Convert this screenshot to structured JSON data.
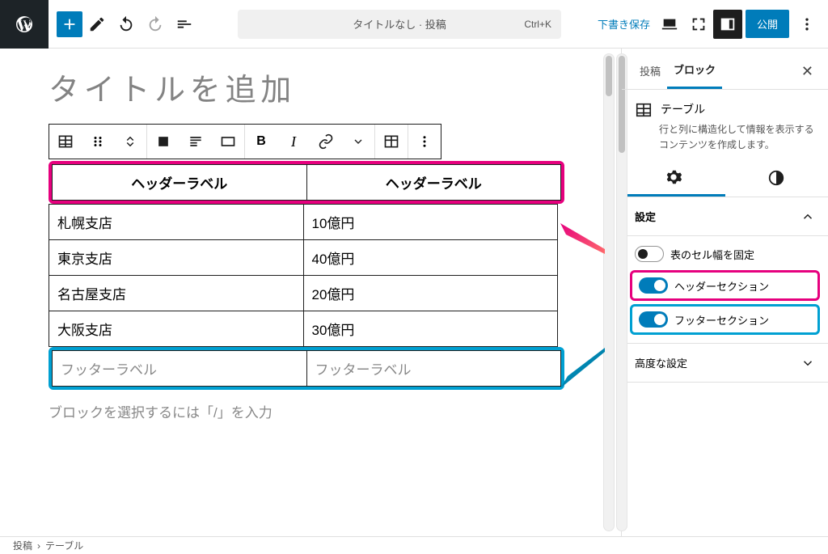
{
  "topbar": {
    "doc_title": "タイトルなし · 投稿",
    "shortcut": "Ctrl+K",
    "save_draft": "下書き保存",
    "publish": "公開"
  },
  "editor": {
    "title_placeholder": "タイトルを追加",
    "block_hint": "ブロックを選択するには「/」を入力"
  },
  "table": {
    "header_labels": [
      "ヘッダーラベル",
      "ヘッダーラベル"
    ],
    "rows": [
      {
        "c0": "札幌支店",
        "c1": "10億円"
      },
      {
        "c0": "東京支店",
        "c1": "40億円"
      },
      {
        "c0": "名古屋支店",
        "c1": "20億円"
      },
      {
        "c0": "大阪支店",
        "c1": "30億円"
      }
    ],
    "footer_labels": [
      "フッターラベル",
      "フッターラベル"
    ]
  },
  "sidebar": {
    "tabs": {
      "post": "投稿",
      "block": "ブロック"
    },
    "block_name": "テーブル",
    "block_desc": "行と列に構造化して情報を表示するコンテンツを作成します。",
    "panels": {
      "settings": "設定",
      "advanced": "高度な設定"
    },
    "toggles": {
      "fixed_width": "表のセル幅を固定",
      "header_section": "ヘッダーセクション",
      "footer_section": "フッターセクション"
    }
  },
  "breadcrumb": {
    "root": "投稿",
    "sep": "›",
    "current": "テーブル"
  }
}
